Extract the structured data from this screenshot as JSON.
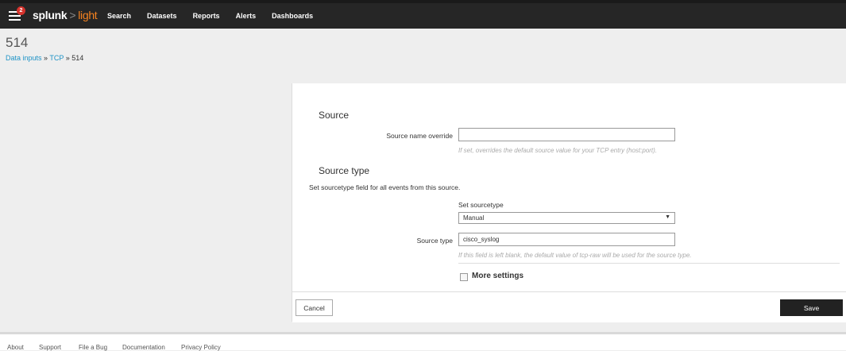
{
  "header": {
    "notification_count": "2",
    "logo": {
      "brand": "splunk",
      "separator": ">",
      "product": "light"
    },
    "nav": [
      "Search",
      "Datasets",
      "Reports",
      "Alerts",
      "Dashboards"
    ]
  },
  "page": {
    "title": "514",
    "breadcrumb": {
      "link1": "Data inputs",
      "sep1": "»",
      "link2": "TCP",
      "sep2": "»",
      "current": "514"
    }
  },
  "form": {
    "source_section_title": "Source",
    "source_name_label": "Source name override",
    "source_name_value": "",
    "source_name_help": "If set, overrides the default source value for your TCP entry (host:port).",
    "sourcetype_section_title": "Source type",
    "sourcetype_description": "Set sourcetype field for all events from this source.",
    "set_sourcetype_label": "Set sourcetype",
    "set_sourcetype_value": "Manual",
    "source_type_label": "Source type",
    "source_type_value": "cisco_syslog",
    "source_type_help": "If this field is left blank, the default value of tcp-raw will be used for the source type.",
    "more_settings_label": "More settings",
    "more_settings_checked": false
  },
  "actions": {
    "cancel_label": "Cancel",
    "save_label": "Save"
  },
  "footer": {
    "links": [
      "About",
      "Support",
      "File a Bug",
      "Documentation",
      "Privacy Policy"
    ]
  },
  "colors": {
    "topbar": "#262626",
    "accent_orange": "#f58220",
    "link_blue": "#1e93c6",
    "save_button": "#222222",
    "badge_red": "#d6332d"
  }
}
